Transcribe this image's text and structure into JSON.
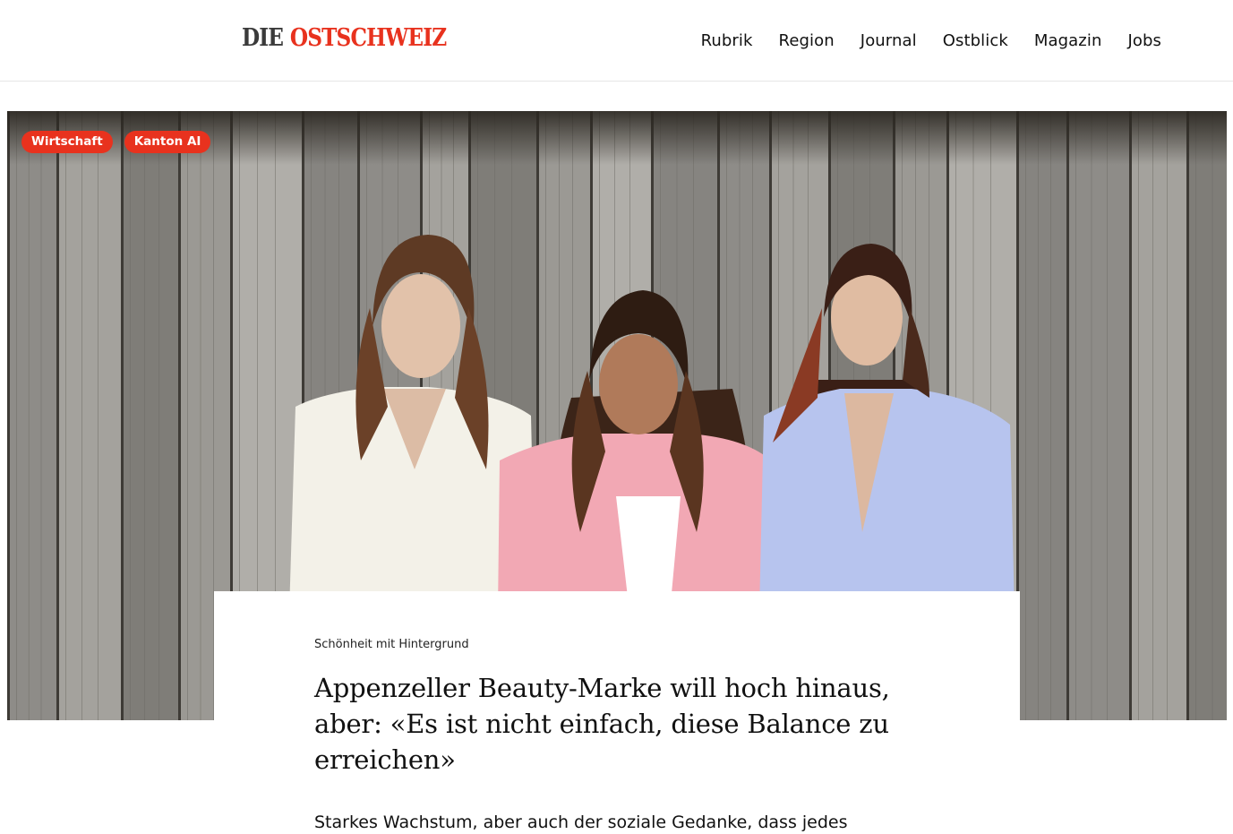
{
  "header": {
    "logo": {
      "part1": "DIE",
      "part2": "OSTSCHWEIZ"
    },
    "nav": [
      "Rubrik",
      "Region",
      "Journal",
      "Ostblick",
      "Magazin",
      "Jobs"
    ]
  },
  "hero": {
    "tags": [
      "Wirtschaft",
      "Kanton AI"
    ]
  },
  "article": {
    "kicker": "Schönheit mit Hintergrund",
    "headline": "Appenzeller Beauty-Marke will hoch hinaus, aber: «Es ist nicht einfach, diese Balance zu erreichen»",
    "lead": "Starkes Wachstum, aber auch der soziale Gedanke, dass jedes"
  },
  "colors": {
    "brand_red": "#e8321e",
    "logo_dark": "#3a3a3a"
  }
}
